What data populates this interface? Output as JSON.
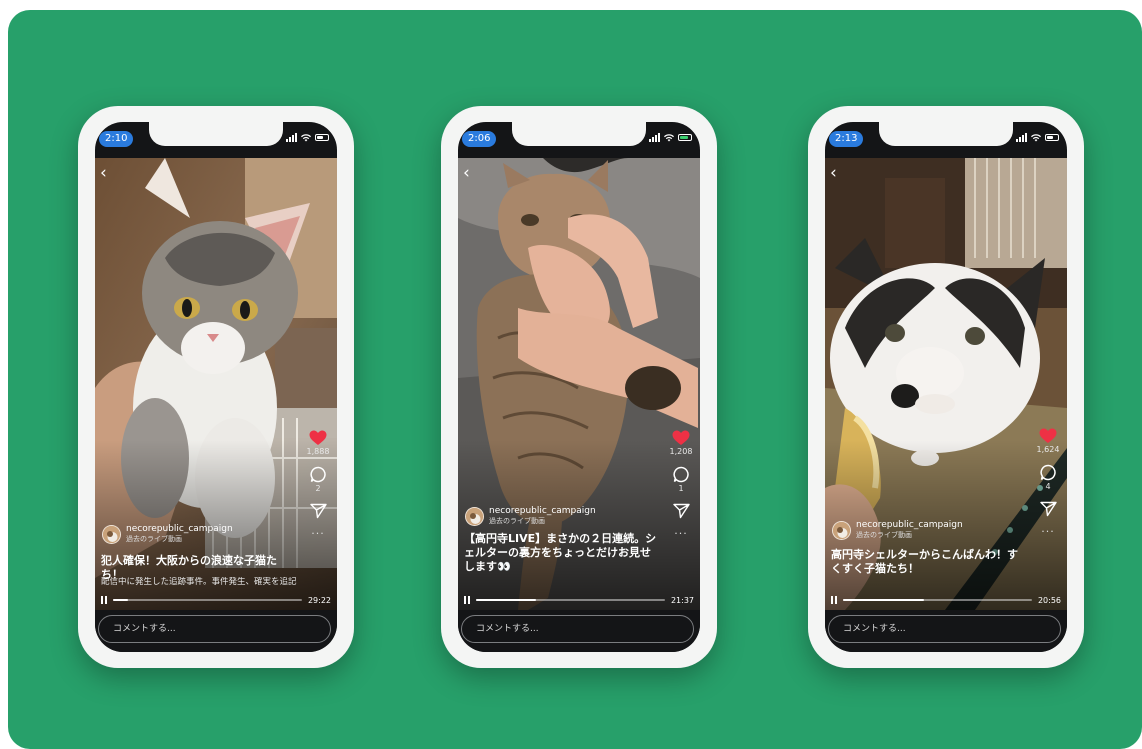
{
  "colors": {
    "background_panel": "#27a06a",
    "like": "#ee3145",
    "time_pill": "#2a7bde"
  },
  "icons": {
    "back": "chevron-left-icon",
    "like": "heart-icon",
    "comment": "comment-bubble-icon",
    "share": "send-icon",
    "more": "more-horizontal-icon",
    "pause": "pause-icon"
  },
  "phones": [
    {
      "time": "2:10",
      "username": "necorepublic_campaign",
      "subtitle": "過去のライブ動画",
      "title": "犯人確保！大阪からの浪速な子猫たち！",
      "description": "配信中に発生した追跡事件。事件発生、確実を追記",
      "likes": "1,888",
      "comments": "2",
      "progress": 0.08,
      "duration": "29:22",
      "comment_placeholder": "コメントする..."
    },
    {
      "time": "2:06",
      "username": "necorepublic_campaign",
      "subtitle": "過去のライブ動画",
      "title": "【高円寺LIVE】まさかの２日連続。シェルターの裏方をちょっとだけお見せします👀",
      "description": "",
      "likes": "1,208",
      "comments": "1",
      "progress": 0.32,
      "duration": "21:37",
      "comment_placeholder": "コメントする..."
    },
    {
      "time": "2:13",
      "username": "necorepublic_campaign",
      "subtitle": "過去のライブ動画",
      "title": "高円寺シェルターからこんばんわ！すくすく子猫たち！",
      "description": "",
      "likes": "1,624",
      "comments": "4",
      "progress": 0.43,
      "duration": "20:56",
      "comment_placeholder": "コメントする..."
    }
  ]
}
